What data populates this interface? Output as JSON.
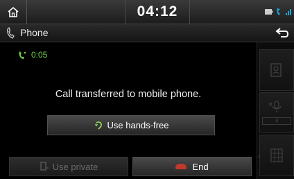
{
  "statusbar": {
    "time": "04:12",
    "icons": [
      "home-icon",
      "battery-icon",
      "bluetooth-phone-icon",
      "signal-icon"
    ]
  },
  "titlebar": {
    "title": "Phone",
    "icons": [
      "phone-icon",
      "back-arrow-icon"
    ]
  },
  "call": {
    "duration": "0:05",
    "message": "Call transferred to mobile phone."
  },
  "buttons": {
    "handsfree_label": "Use hands-free",
    "private_label": "Use private",
    "end_label": "End"
  },
  "side_panel": {
    "volume_value": "3",
    "icons": [
      "contacts-icon",
      "microphone-mute-icon",
      "keypad-icon"
    ]
  },
  "colors": {
    "duration_green": "#6fcf4a",
    "end_red": "#c0392b",
    "accent_cyan": "#1aa3d9"
  }
}
